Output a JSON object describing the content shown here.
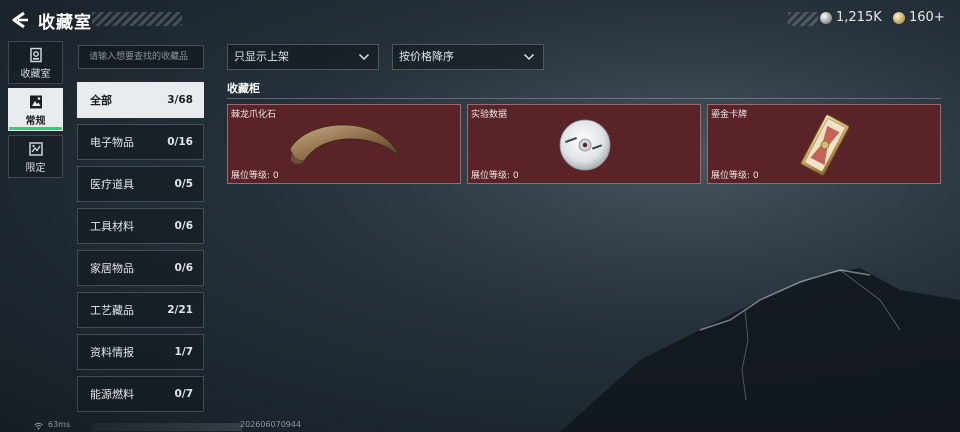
{
  "header": {
    "title": "收藏室",
    "back_icon": "back-arrow-icon",
    "currency": [
      {
        "icon": "silver-coin-icon",
        "value": "1,215K"
      },
      {
        "icon": "gold-coin-icon",
        "value": "160+"
      }
    ]
  },
  "sidebar": {
    "items": [
      {
        "icon": "collection-room-icon",
        "label": "收藏室",
        "active": false
      },
      {
        "icon": "regular-icon",
        "label": "常规",
        "active": true
      },
      {
        "icon": "limited-icon",
        "label": "限定",
        "active": false
      }
    ]
  },
  "search": {
    "placeholder": "请输入想要查找的收藏品"
  },
  "categories": [
    {
      "name": "全部",
      "count": "3/68",
      "active": true
    },
    {
      "name": "电子物品",
      "count": "0/16",
      "active": false
    },
    {
      "name": "医疗道具",
      "count": "0/5",
      "active": false
    },
    {
      "name": "工具材料",
      "count": "0/6",
      "active": false
    },
    {
      "name": "家居物品",
      "count": "0/6",
      "active": false
    },
    {
      "name": "工艺藏品",
      "count": "2/21",
      "active": false
    },
    {
      "name": "资料情报",
      "count": "1/7",
      "active": false
    },
    {
      "name": "能源燃料",
      "count": "0/7",
      "active": false
    }
  ],
  "filters": {
    "shelf_filter": "只显示上架",
    "sort_order": "按价格降序"
  },
  "cabinet": {
    "title": "收藏柜",
    "items": [
      {
        "name": "棘龙爪化石",
        "level": "展位等级: 0",
        "icon": "dinosaur-claw-fossil-icon"
      },
      {
        "name": "实验数据",
        "level": "展位等级: 0",
        "icon": "data-disc-icon"
      },
      {
        "name": "鎏金卡牌",
        "level": "展位等级: 0",
        "icon": "gilded-card-icon"
      }
    ]
  },
  "status": {
    "ping": "63ms",
    "timestamp": "202606070944"
  },
  "colors": {
    "active_tab_accent": "#2fcf7b",
    "card_background": "#5a2328",
    "active_background": "#e9ecee"
  }
}
